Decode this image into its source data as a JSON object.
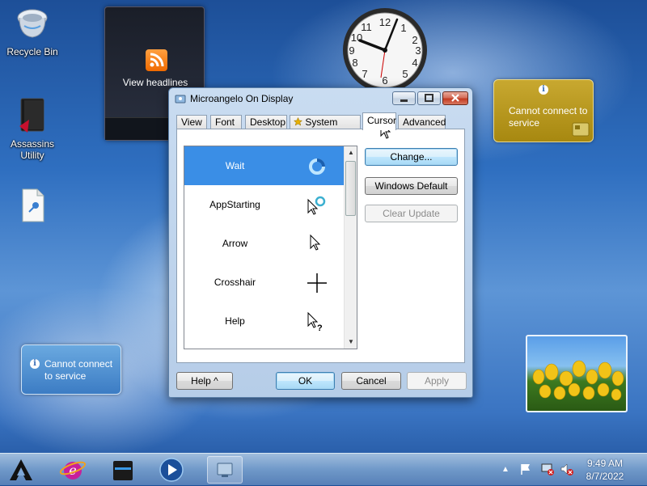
{
  "desktop": {
    "icons": [
      {
        "label": "Recycle Bin",
        "icon": "recycle-bin-icon"
      },
      {
        "label": "Assassins Utility",
        "icon": "folder-icon"
      },
      {
        "label": "",
        "icon": "document-icon"
      }
    ]
  },
  "gadgets": {
    "headlines_label": "View headlines",
    "weather_gold_message": "Cannot connect to service",
    "weather_blue_message": "Cannot connect to service",
    "info_glyph": "i"
  },
  "dialog": {
    "title": "Microangelo On Display",
    "tabs": [
      "View",
      "Font",
      "Desktop",
      "System Icons",
      "Cursor",
      "Advanced"
    ],
    "active_tab": "Cursor",
    "cursor_list": [
      {
        "name": "Wait",
        "selected": true
      },
      {
        "name": "AppStarting",
        "selected": false
      },
      {
        "name": "Arrow",
        "selected": false
      },
      {
        "name": "Crosshair",
        "selected": false
      },
      {
        "name": "Help",
        "selected": false
      }
    ],
    "buttons": {
      "change": "Change...",
      "windows_default": "Windows Default",
      "clear_update": "Clear Update",
      "help": "Help ^",
      "ok": "OK",
      "cancel": "Cancel",
      "apply": "Apply"
    }
  },
  "taskbar": {
    "time": "9:49 AM",
    "date": "8/7/2022"
  },
  "colors": {
    "selection": "#3a8ee6",
    "accent": "#3c7fb1"
  }
}
